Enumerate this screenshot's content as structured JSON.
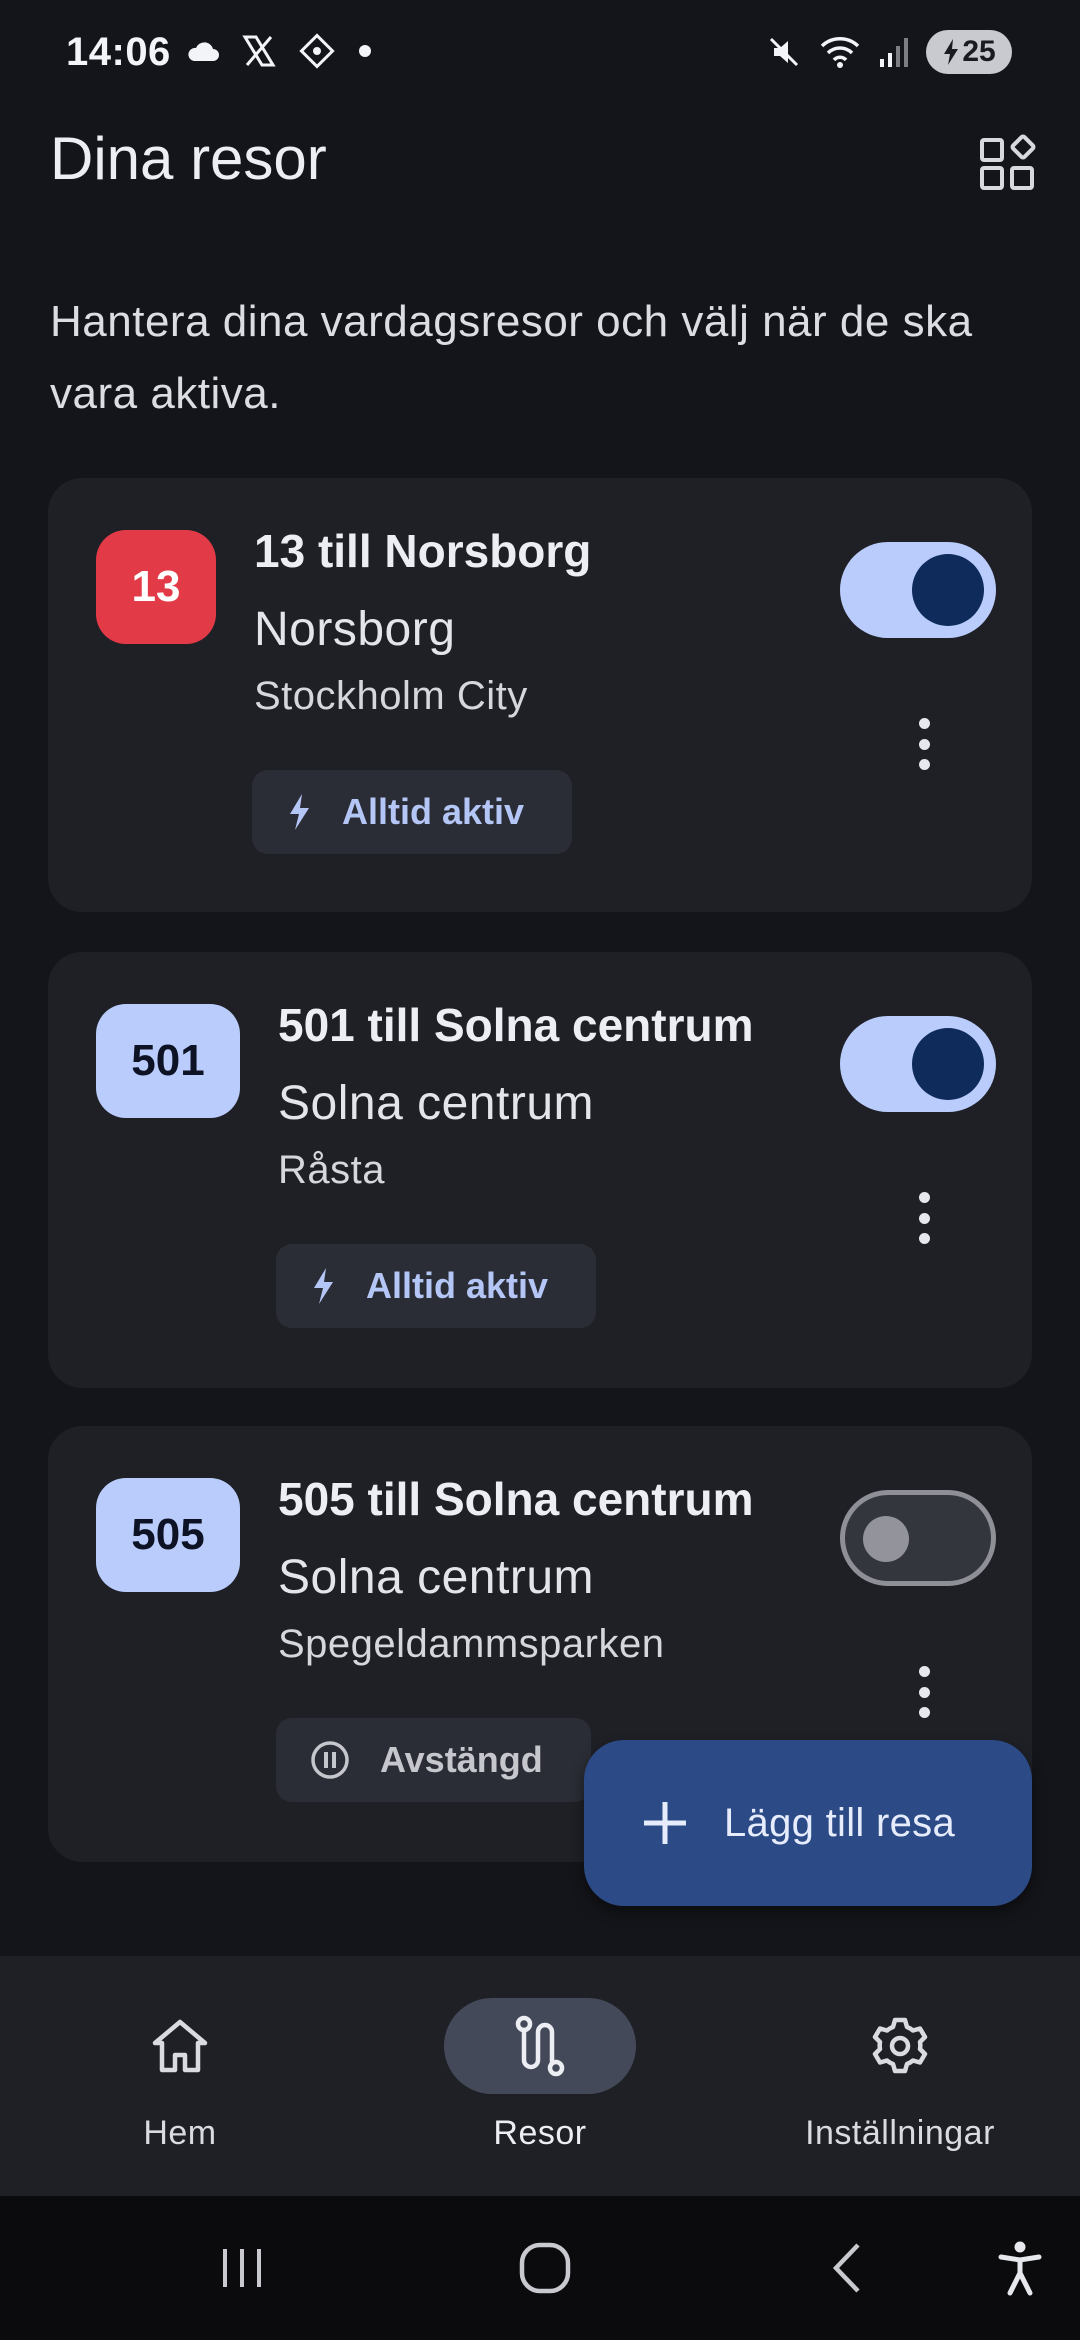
{
  "status_bar": {
    "time": "14:06",
    "battery": "25",
    "left_icons": [
      "cloud-icon",
      "x-logo-icon",
      "diamond-app-icon",
      "dot-icon"
    ],
    "right_icons": [
      "mute-icon",
      "wifi-icon",
      "signal-icon",
      "battery-charging-icon"
    ]
  },
  "header": {
    "title": "Dina resor",
    "subtitle": "Hantera dina vardagsresor och välj när de ska vara aktiva.",
    "grid_icon": "widgets-icon"
  },
  "trips": [
    {
      "line": "13",
      "badge_color": "#e33a47",
      "title": "13 till Norsborg",
      "destination": "Norsborg",
      "from": "Stockholm City",
      "status_label": "Alltid aktiv",
      "status_icon": "bolt-icon",
      "enabled": true
    },
    {
      "line": "501",
      "badge_color": "#b9ccfb",
      "title": "501 till Solna centrum",
      "destination": "Solna centrum",
      "from": "Råsta",
      "status_label": "Alltid aktiv",
      "status_icon": "bolt-icon",
      "enabled": true
    },
    {
      "line": "505",
      "badge_color": "#b9ccfb",
      "title": "505 till Solna centrum",
      "destination": "Solna centrum",
      "from": "Spegeldammsparken",
      "status_label": "Avstängd",
      "status_icon": "pause-icon",
      "enabled": false
    }
  ],
  "fab": {
    "label": "Lägg till resa",
    "icon": "plus-icon"
  },
  "bottom_nav": {
    "items": [
      {
        "label": "Hem",
        "icon": "home-icon",
        "selected": false
      },
      {
        "label": "Resor",
        "icon": "route-icon",
        "selected": true
      },
      {
        "label": "Inställningar",
        "icon": "gear-icon",
        "selected": false
      }
    ]
  },
  "system_nav": [
    "recents-icon",
    "home-circle-icon",
    "back-icon",
    "accessibility-icon"
  ],
  "colors": {
    "background": "#14151a",
    "card": "#1f2026",
    "accent": "#b9ccfb",
    "toggle_knob": "#0f2b5c",
    "fab": "#2b4a86",
    "red_line": "#e33a47"
  }
}
